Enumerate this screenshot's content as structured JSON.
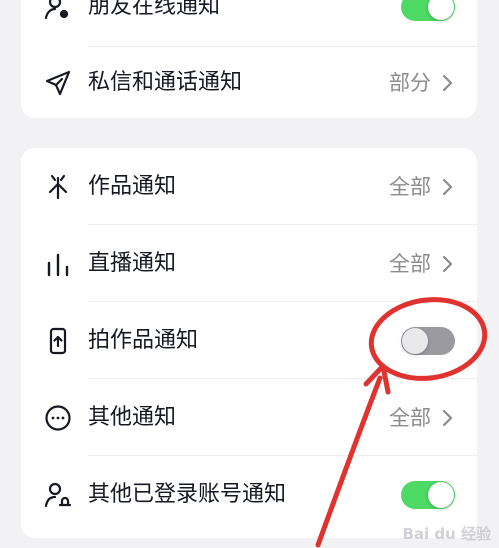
{
  "card_top": {
    "rows": [
      {
        "label": "朋友在线通知",
        "icon": "friend-online-icon",
        "toggle": true
      },
      {
        "label": "私信和通话通知",
        "icon": "send-plane-icon",
        "value": "部分"
      }
    ]
  },
  "card_main": {
    "rows": [
      {
        "label": "作品通知",
        "icon": "works-spark-icon",
        "value": "全部"
      },
      {
        "label": "直播通知",
        "icon": "live-bars-icon",
        "value": "全部"
      },
      {
        "label": "拍作品通知",
        "icon": "phone-upload-icon",
        "toggle": false
      },
      {
        "label": "其他通知",
        "icon": "more-dots-icon",
        "value": "全部"
      },
      {
        "label": "其他已登录账号通知",
        "icon": "account-bell-icon",
        "toggle": true
      }
    ]
  },
  "watermark": "Bai du 经验",
  "colors": {
    "toggle_on": "#4cd964",
    "toggle_off": "#9a9aa0",
    "annotation_red": "#e0322e",
    "value_gray": "#8a8b91"
  }
}
